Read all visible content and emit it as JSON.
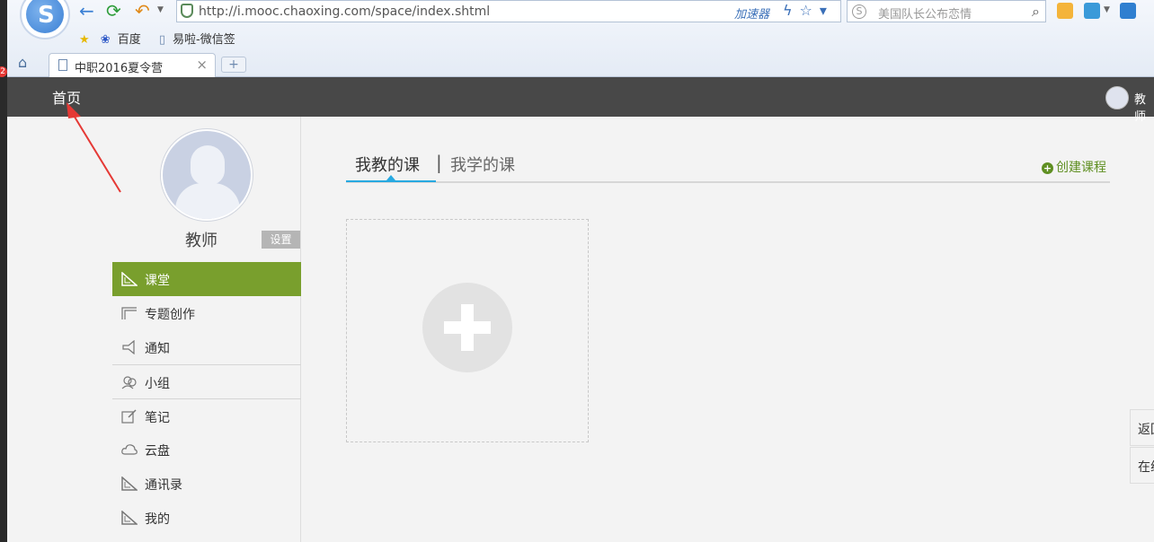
{
  "browser": {
    "url": "http://i.mooc.chaoxing.com/space/index.shtml",
    "accelerator": "加速器",
    "search_placeholder": "美国队长公布恋情",
    "bookmarks": [
      "百度",
      "易啦-微信签"
    ],
    "tab_title": "中职2016夏令营",
    "new_tab": "+",
    "notification_count": "2"
  },
  "header": {
    "home": "首页",
    "user_name": "教师"
  },
  "profile": {
    "name": "教师",
    "settings": "设置"
  },
  "sidebar": {
    "items": [
      {
        "label": "课堂",
        "icon": "ruler-triangle-icon"
      },
      {
        "label": "专题创作",
        "icon": "frame-icon"
      },
      {
        "label": "通知",
        "icon": "megaphone-icon"
      },
      {
        "label": "小组",
        "icon": "group-icon"
      },
      {
        "label": "笔记",
        "icon": "note-edit-icon"
      },
      {
        "label": "云盘",
        "icon": "cloud-icon"
      },
      {
        "label": "通讯录",
        "icon": "ruler-triangle-icon"
      },
      {
        "label": "我的",
        "icon": "ruler-triangle-icon"
      }
    ]
  },
  "main": {
    "tab_teach": "我教的课",
    "tab_divider": "|",
    "tab_learn": "我学的课",
    "create_course": "创建课程"
  },
  "floats": {
    "back": "返回",
    "online": "在线"
  },
  "colors": {
    "active": "#799f2d",
    "header_bg": "#484848",
    "tab_accent": "#27a9e1",
    "create_green": "#5f8f22"
  }
}
